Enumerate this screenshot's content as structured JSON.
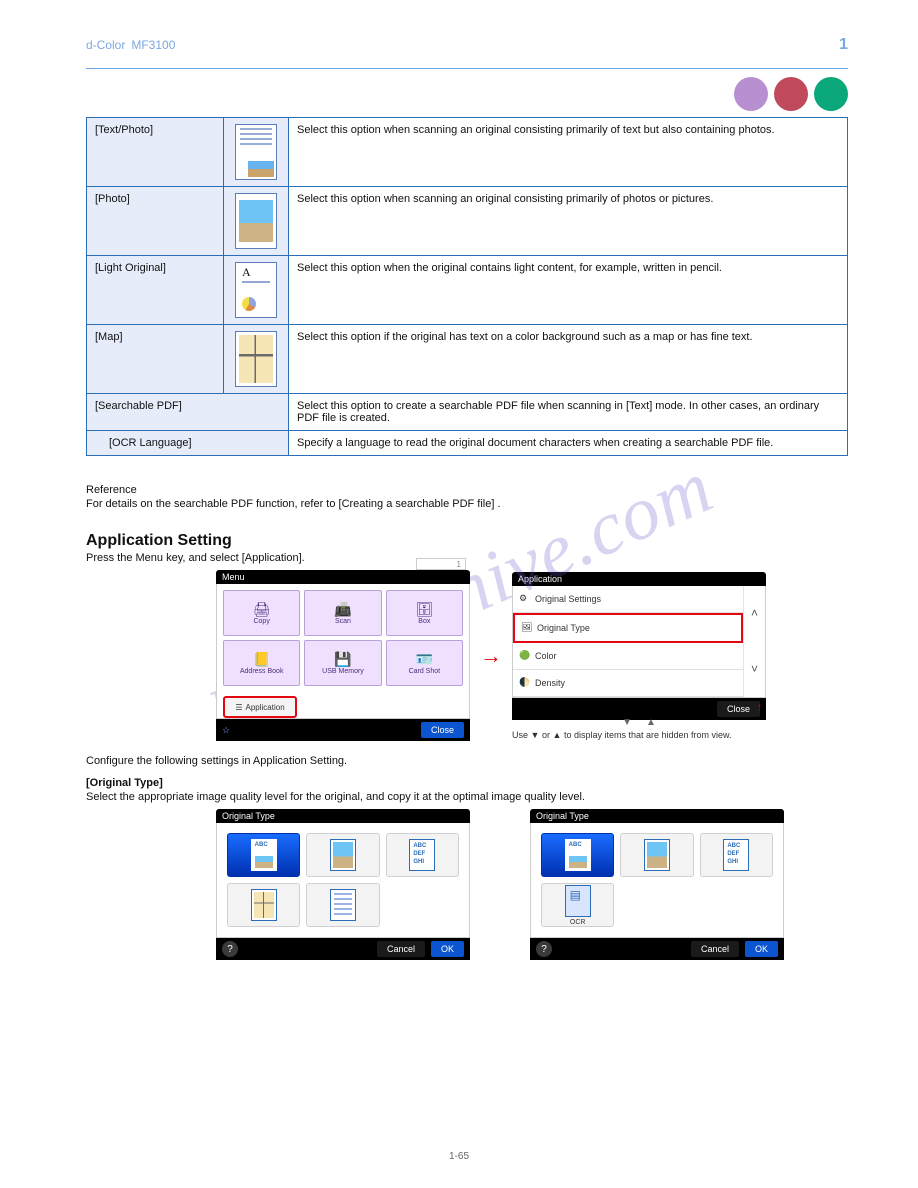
{
  "header": {
    "breadcrumb_left": "d-Color",
    "breadcrumb_right": "MF3100",
    "section_number": "1"
  },
  "watermark": "manualshive.com",
  "page_number": "1-65",
  "image_types": [
    {
      "label": "[Text/Photo]",
      "desc": "Select this option when scanning an original consisting primarily of text but also containing photos."
    },
    {
      "label": "[Photo]",
      "desc": "Select this option when scanning an original consisting primarily of photos or pictures."
    },
    {
      "label": "[Light Original]",
      "desc": "Select this option when the original contains light content, for example, written in pencil."
    },
    {
      "label": "[Map]",
      "desc": "Select this option if the original has text on a color background such as a map or has fine text."
    },
    {
      "label": "[Searchable PDF]",
      "desc": "Select this option to create a searchable PDF file when scanning in [Text] mode. In other cases, an ordinary PDF file is created."
    },
    {
      "label": "[OCR Language]",
      "desc": "Specify a language to read the original document characters when creating a searchable PDF file.",
      "indent": true
    }
  ],
  "note": {
    "label": "Reference",
    "body": "For details on the searchable PDF function, refer to [Creating a searchable PDF file] ."
  },
  "section": {
    "title": "Application Setting",
    "desc1": "Press the Menu key, and select [Application].",
    "desc2": "Configure the following settings in Application Setting."
  },
  "menu_screenshot": {
    "title": "Menu",
    "counter": "1",
    "tiles": [
      {
        "label": "Copy",
        "kind": "copier"
      },
      {
        "label": "Scan",
        "kind": "scan"
      },
      {
        "label": "Box",
        "kind": "box"
      },
      {
        "label": "Address\nBook",
        "kind": "addr"
      },
      {
        "label": "USB\nMemory",
        "kind": "usb"
      },
      {
        "label": "Card\nShot",
        "kind": "card"
      }
    ],
    "app_button": "Application",
    "close": "Close"
  },
  "app_list_screenshot": {
    "title": "Application",
    "rows": [
      {
        "label": "Original Settings"
      },
      {
        "label": "Original Type",
        "selected": true
      },
      {
        "label": "Color"
      },
      {
        "label": "Density"
      }
    ],
    "close": "Close",
    "hint_down": "▼",
    "hint_up": "▲",
    "scroll_note_use": "Use",
    "scroll_note_or": "or",
    "scroll_note_rest": "to display items that are hidden from view."
  },
  "original_type": {
    "title": "[Original Type]",
    "desc": "Select the appropriate image quality level for the original, and copy it at the optimal image quality level.",
    "titlebar": "Original Type",
    "grid_a": [
      {
        "kind": "text-photo",
        "sel": true
      },
      {
        "kind": "photo"
      },
      {
        "kind": "text"
      },
      {
        "kind": "map"
      },
      {
        "kind": "light"
      }
    ],
    "grid_b": [
      {
        "kind": "text-photo",
        "sel": true
      },
      {
        "kind": "photo"
      },
      {
        "kind": "text"
      },
      {
        "kind": "ocr",
        "label": "OCR"
      }
    ],
    "cancel": "Cancel",
    "ok": "OK"
  }
}
